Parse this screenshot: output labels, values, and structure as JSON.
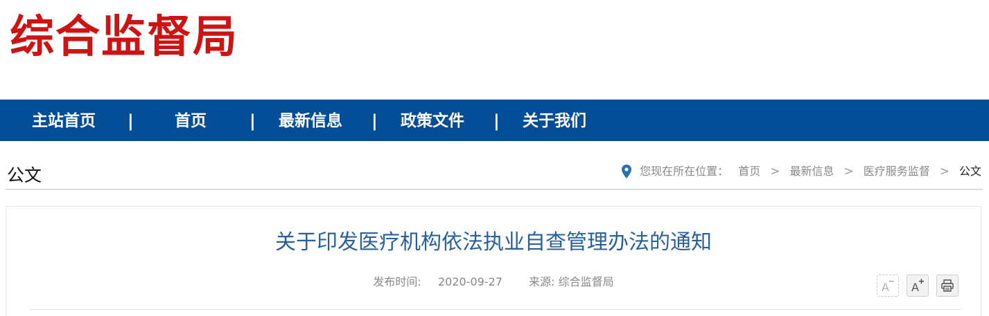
{
  "site": {
    "logo_text": "综合监督局"
  },
  "nav": {
    "items": [
      {
        "label": "主站首页"
      },
      {
        "label": "首页"
      },
      {
        "label": "最新信息"
      },
      {
        "label": "政策文件"
      },
      {
        "label": "关于我们"
      }
    ],
    "separator": "|"
  },
  "section": {
    "title": "公文"
  },
  "breadcrumb": {
    "prefix": "您现在所在位置：",
    "items": [
      "首页",
      "最新信息",
      "医疗服务监督",
      "公文"
    ],
    "separator": ">"
  },
  "article": {
    "title": "关于印发医疗机构依法执业自查管理办法的通知",
    "publish_label": "发布时间:",
    "publish_date": "2020-09-27",
    "source_label": "来源:",
    "source": "综合监督局"
  },
  "tools": {
    "icons": [
      "font-decrease-icon",
      "font-increase-icon",
      "print-icon"
    ]
  },
  "colors": {
    "logo": "#cc1414",
    "nav_bg": "#044e98",
    "title": "#27609f",
    "accent_underline": "#0a4f95"
  }
}
